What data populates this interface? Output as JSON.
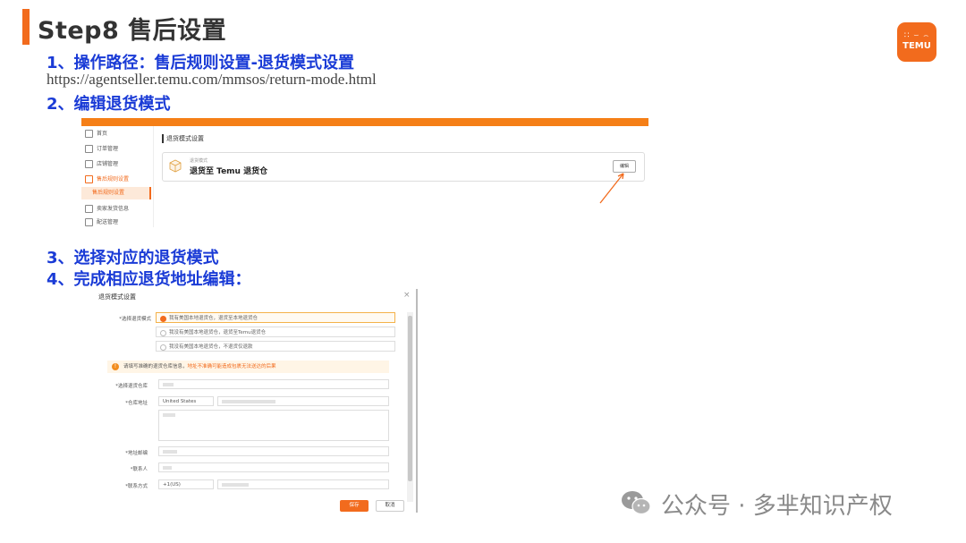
{
  "header": {
    "title": "Step8 售后设置",
    "accent_color": "#f26b1d"
  },
  "logo": {
    "row1": "∷ ⌣ ⌢",
    "row2": "TEMU",
    "color": "#f26b1d"
  },
  "steps": {
    "step1": "1、操作路径：售后规则设置-退货模式设置",
    "url": "https://agentseller.temu.com/mmsos/return-mode.html",
    "step2": "2、编辑退货模式",
    "step3": "3、选择对应的退货模式",
    "step4": "4、完成相应退货地址编辑："
  },
  "screenshot1": {
    "sidebar": [
      {
        "label": "首页"
      },
      {
        "label": "订单管理"
      },
      {
        "label": "店铺管理"
      },
      {
        "label": "售后规则设置"
      },
      {
        "label": "售后规则设置"
      },
      {
        "label": "卖家发货信息"
      },
      {
        "label": "配送管理"
      }
    ],
    "section_title": "退货模式设置",
    "card_small": "退货模式",
    "card_title": "退货至 Temu 退货仓",
    "edit_button": "编辑"
  },
  "screenshot2": {
    "dialog_title": "退货模式设置",
    "close_icon": "×",
    "mode_label": "*选择退货模式",
    "options": [
      "我有美国本地退货仓，退货至本地退货仓",
      "我没有美国本地退货仓，退货至Temu退货仓",
      "我没有美国本地退货仓，不退货仅退款"
    ],
    "warning_text": "请填写准确的退货仓库信息，",
    "warning_highlight": "地址不准确可能造成包裹无法送达的后果",
    "fields": {
      "warehouse_label": "*选择退货仓库",
      "address_label": "*仓库地址",
      "country_value": "United States",
      "zip_label": "*地址邮编",
      "contact_label": "*联系人",
      "phone_label": "*联系方式",
      "phone_code": "+1(US)"
    },
    "save_button": "保存",
    "cancel_button": "取消"
  },
  "watermark": {
    "text": "公众号 · 多芈知识产权"
  }
}
